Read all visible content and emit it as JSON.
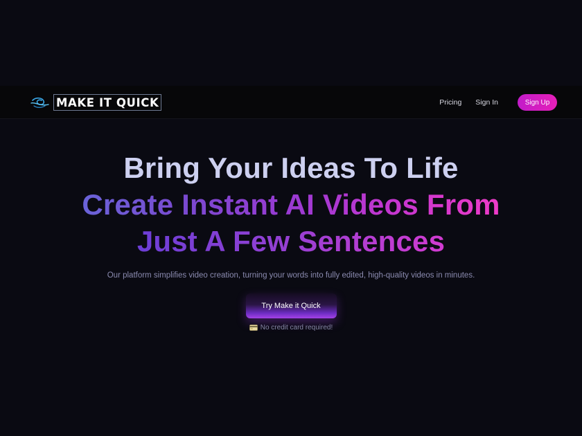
{
  "header": {
    "logo_text": "MAKE IT QUICK",
    "nav": {
      "pricing": "Pricing",
      "sign_in": "Sign In",
      "sign_up": "Sign Up"
    }
  },
  "hero": {
    "headline_line1": "Bring Your Ideas To Life",
    "headline_line2": "Create Instant AI Videos From",
    "headline_line3": "Just A Few Sentences",
    "subtitle": "Our platform simplifies video creation, turning your words into fully edited, high-quality videos in minutes.",
    "cta_label": "Try Make it Quick",
    "note": "No credit card required!",
    "note_icon": "credit-card-icon"
  },
  "colors": {
    "background": "#0a0a12",
    "navbar": "#070709",
    "accent_pink": "#e51fb8",
    "accent_purple": "#7a49d0",
    "headline_light": "#cdd0f0"
  }
}
